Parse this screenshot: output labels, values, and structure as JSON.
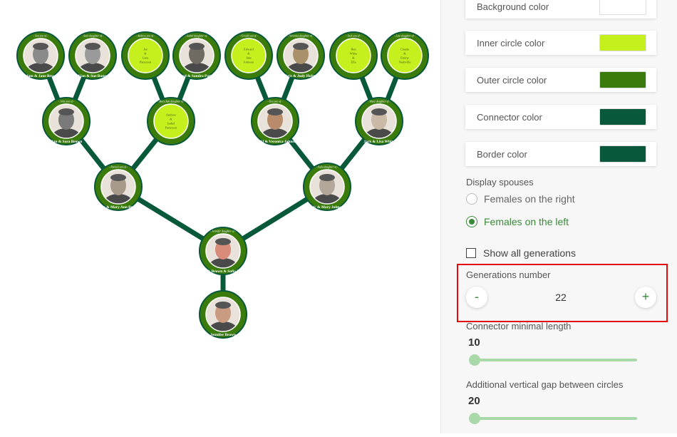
{
  "colors": {
    "background": "#ffffff",
    "inner_circle": "#c6ef1e",
    "outer_circle": "#3a7b0b",
    "connector": "#08593a",
    "border": "#08593a"
  },
  "tree": {
    "people": [
      {
        "id": "g1",
        "name": "Adam & Jane Brown",
        "top": "- Son son of -"
      },
      {
        "id": "g2",
        "name": "Alan & Sue Bange",
        "top": "- Sara daughter of -"
      },
      {
        "id": "g3",
        "name": "",
        "top": "- Andrew son of -",
        "inner": [
          "Joe",
          "&",
          "Lana",
          "Patterson"
        ]
      },
      {
        "id": "g4",
        "name": "Richard & Sandra Patterson",
        "top": "- Isabel daughter of -"
      },
      {
        "id": "g5",
        "name": "",
        "top": "- Gerald son of -",
        "inner": [
          "Edward",
          "&",
          "Jane",
          "Johnson"
        ]
      },
      {
        "id": "g6",
        "name": "Chris & Judy Holmes",
        "top": "- Veronica daughter of -"
      },
      {
        "id": "g7",
        "name": "",
        "top": "- Jack son of -",
        "inner": [
          "Ben",
          "White",
          "&",
          "Ella"
        ]
      },
      {
        "id": "g8",
        "name": "",
        "top": "- Lisa daughter of -",
        "inner": [
          "Claude",
          "&",
          "Emmy",
          "Nashville"
        ]
      },
      {
        "id": "p1",
        "name": "Dan & Sara Brown",
        "top": "- John son of -"
      },
      {
        "id": "p2",
        "name": "",
        "top": "- Mary Ann daughter of -",
        "inner": [
          "Andrew",
          "&",
          "Isabel",
          "Patterson"
        ]
      },
      {
        "id": "p3",
        "name": "Gerald & Veronica Johnson",
        "top": "- Eva son of -"
      },
      {
        "id": "p4",
        "name": "Jack & Lisa White",
        "top": "- Mary daughter of -"
      },
      {
        "id": "c1",
        "name": "John & Mary Ann Brown",
        "top": "- Patrick son of -"
      },
      {
        "id": "c2",
        "name": "Eric & Mary Johnson",
        "top": "- Sofia daughter of -"
      },
      {
        "id": "s1",
        "name": "Patrick Brown & Sofia Brown",
        "top": "- Jennifer daughter of -"
      },
      {
        "id": "r1",
        "name": "Jennifer Brown",
        "top": ""
      }
    ]
  },
  "panel": {
    "color_rows": [
      {
        "label": "Background color",
        "color": "#ffffff"
      },
      {
        "label": "Inner circle color",
        "color": "#c6ef1e"
      },
      {
        "label": "Outer circle color",
        "color": "#3a7b0b"
      },
      {
        "label": "Connector color",
        "color": "#08593a"
      },
      {
        "label": "Border color",
        "color": "#08593a"
      }
    ],
    "display_spouses_label": "Display spouses",
    "spouse_options": [
      {
        "label": "Females on the right",
        "selected": false
      },
      {
        "label": "Females on the left",
        "selected": true
      }
    ],
    "show_all_generations_label": "Show all generations",
    "show_all_generations_checked": false,
    "generations": {
      "label": "Generations number",
      "value": "22",
      "minus": "-",
      "plus": "+"
    },
    "connector_min_length": {
      "label": "Connector minimal length",
      "value": "10"
    },
    "vertical_gap": {
      "label": "Additional vertical gap between circles",
      "value": "20"
    }
  }
}
